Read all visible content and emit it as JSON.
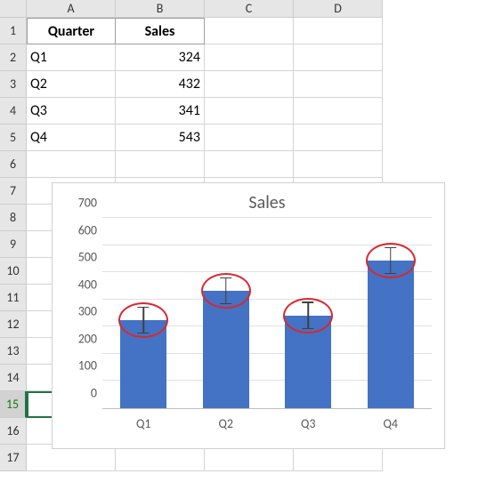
{
  "columns": [
    "A",
    "B",
    "C",
    "D"
  ],
  "rows": [
    "1",
    "2",
    "3",
    "4",
    "5",
    "6",
    "7",
    "8",
    "9",
    "10",
    "11",
    "12",
    "13",
    "14",
    "15",
    "16",
    "17"
  ],
  "table": {
    "headers": [
      "Quarter",
      "Sales"
    ],
    "data": [
      {
        "q": "Q1",
        "v": 324
      },
      {
        "q": "Q2",
        "v": 432
      },
      {
        "q": "Q3",
        "v": 341
      },
      {
        "q": "Q4",
        "v": 543
      }
    ]
  },
  "selected_row": "15",
  "chart_data": {
    "type": "bar",
    "title": "Sales",
    "categories": [
      "Q1",
      "Q2",
      "Q3",
      "Q4"
    ],
    "values": [
      324,
      432,
      341,
      543
    ],
    "error_amount": 50,
    "ylim": [
      0,
      700
    ],
    "ytick": 100,
    "annotations": "red ellipses circling each error bar"
  }
}
